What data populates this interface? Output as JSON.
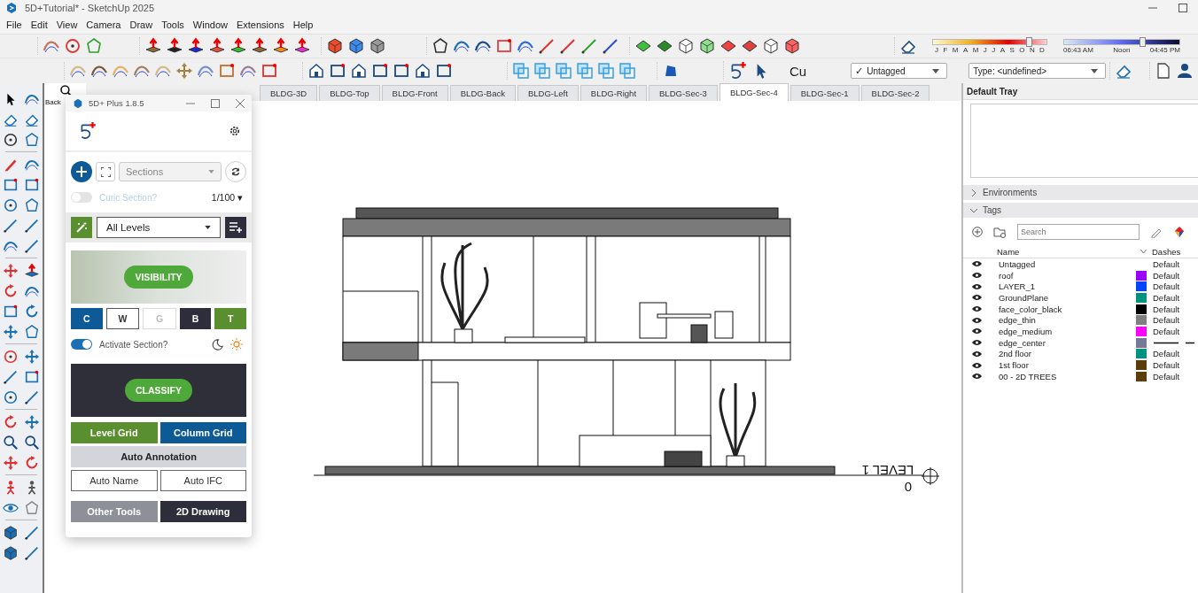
{
  "window": {
    "title": "5D+Tutorial* - SketchUp 2025"
  },
  "menu": [
    "File",
    "Edit",
    "View",
    "Camera",
    "Draw",
    "Tools",
    "Window",
    "Extensions",
    "Help"
  ],
  "toolbar": {
    "date_slider": {
      "level": 0.84,
      "labels": [
        "J",
        "F",
        "M",
        "A",
        "M",
        "J",
        "J",
        "A",
        "S",
        "O",
        "N",
        "D"
      ]
    },
    "time_slider": {
      "level": 0.68,
      "labels": [
        "06:43 AM",
        "Noon",
        "04:45 PM"
      ]
    },
    "text_tool": "Cu",
    "tag_dropdown": {
      "check": "✓",
      "value": "Untagged"
    },
    "type_dropdown": {
      "value": "Type: <undefined>"
    }
  },
  "back_label": "Back",
  "tabs": [
    {
      "label": "BLDG-3D",
      "selected": false
    },
    {
      "label": "BLDG-Top",
      "selected": false
    },
    {
      "label": "BLDG-Front",
      "selected": false
    },
    {
      "label": "BLDG-Back",
      "selected": false
    },
    {
      "label": "BLDG-Left",
      "selected": false
    },
    {
      "label": "BLDG-Right",
      "selected": false
    },
    {
      "label": "BLDG-Sec-3",
      "selected": false
    },
    {
      "label": "BLDG-Sec-4",
      "selected": true
    },
    {
      "label": "BLDG-Sec-1",
      "selected": false
    },
    {
      "label": "BLDG-Sec-2",
      "selected": false
    }
  ],
  "plugin": {
    "title": "5D+ Plus 1.8.5",
    "section_select": {
      "placeholder": "Sections"
    },
    "curic_toggle": {
      "label": "Curic Section?",
      "on": false
    },
    "scale": {
      "value": "1/100",
      "caret": "▾"
    },
    "level_select": {
      "value": "All Levels"
    },
    "visibility_button": "VISIBILITY",
    "filters": [
      {
        "label": "C",
        "kind": "filled",
        "color": "#0e5a96",
        "disabled": false
      },
      {
        "label": "W",
        "kind": "outline",
        "color": "#ffffff",
        "disabled": false
      },
      {
        "label": "G",
        "kind": "outline",
        "color": "#ffffff",
        "disabled": true
      },
      {
        "label": "B",
        "kind": "filled",
        "color": "#2d2d3c",
        "disabled": false
      },
      {
        "label": "T",
        "kind": "filled",
        "color": "#5a8f2f",
        "disabled": false
      }
    ],
    "activate_toggle": {
      "label": "Activate Section?",
      "on": true
    },
    "classify_button": "CLASSIFY",
    "tools": [
      {
        "label": "Level Grid",
        "kind": "filled",
        "color": "#5a8f2f",
        "wide": false
      },
      {
        "label": "Column Grid",
        "kind": "filled",
        "color": "#0e5a96",
        "wide": false
      },
      {
        "label": "Auto Annotation",
        "kind": "light",
        "color": "#d3d5da",
        "wide": true
      },
      {
        "label": "Auto Name",
        "kind": "outline",
        "color": "#ffffff",
        "wide": false
      },
      {
        "label": "Auto IFC",
        "kind": "outline",
        "color": "#ffffff",
        "wide": false
      },
      {
        "label": "Other Tools",
        "kind": "filled",
        "color": "#8e9099",
        "wide": false
      },
      {
        "label": "2D Drawing",
        "kind": "filled",
        "color": "#2d2d3c",
        "wide": false
      }
    ]
  },
  "canvas": {
    "level_label": "LEVEL 1",
    "level_value": "0"
  },
  "tray": {
    "title": "Default Tray",
    "panels": [
      {
        "label": "Environments",
        "expanded": false
      },
      {
        "label": "Tags",
        "expanded": true
      }
    ],
    "search": {
      "placeholder": "Search"
    },
    "columns": [
      "Name",
      "Dashes"
    ],
    "rows": [
      {
        "name": "Untagged",
        "visible": true,
        "kind": "text",
        "dashes": "Default"
      },
      {
        "name": "roof",
        "visible": true,
        "color": "#9900ff",
        "kind": "text",
        "dashes": "Default"
      },
      {
        "name": "LAYER_1",
        "visible": true,
        "color": "#0044ff",
        "kind": "text",
        "dashes": "Default"
      },
      {
        "name": "GroundPlane",
        "visible": true,
        "color": "#009480",
        "kind": "text",
        "dashes": "Default"
      },
      {
        "name": "face_color_black",
        "visible": true,
        "color": "#000000",
        "kind": "text",
        "dashes": "Default"
      },
      {
        "name": "edge_thin",
        "visible": true,
        "color": "#7f7f7f",
        "kind": "text",
        "dashes": "Default"
      },
      {
        "name": "edge_medium",
        "visible": true,
        "color": "#ff00ff",
        "kind": "text",
        "dashes": "Default"
      },
      {
        "name": "edge_center",
        "visible": true,
        "color": "#77779a",
        "kind": "pattern"
      },
      {
        "name": "2nd floor",
        "visible": true,
        "color": "#009480",
        "kind": "text",
        "dashes": "Default"
      },
      {
        "name": "1st floor",
        "visible": true,
        "color": "#5c3d0a",
        "kind": "text",
        "dashes": "Default"
      },
      {
        "name": "00 - 2D TREES",
        "visible": true,
        "color": "#5c3d0a",
        "kind": "text",
        "dashes": "Default"
      }
    ]
  }
}
